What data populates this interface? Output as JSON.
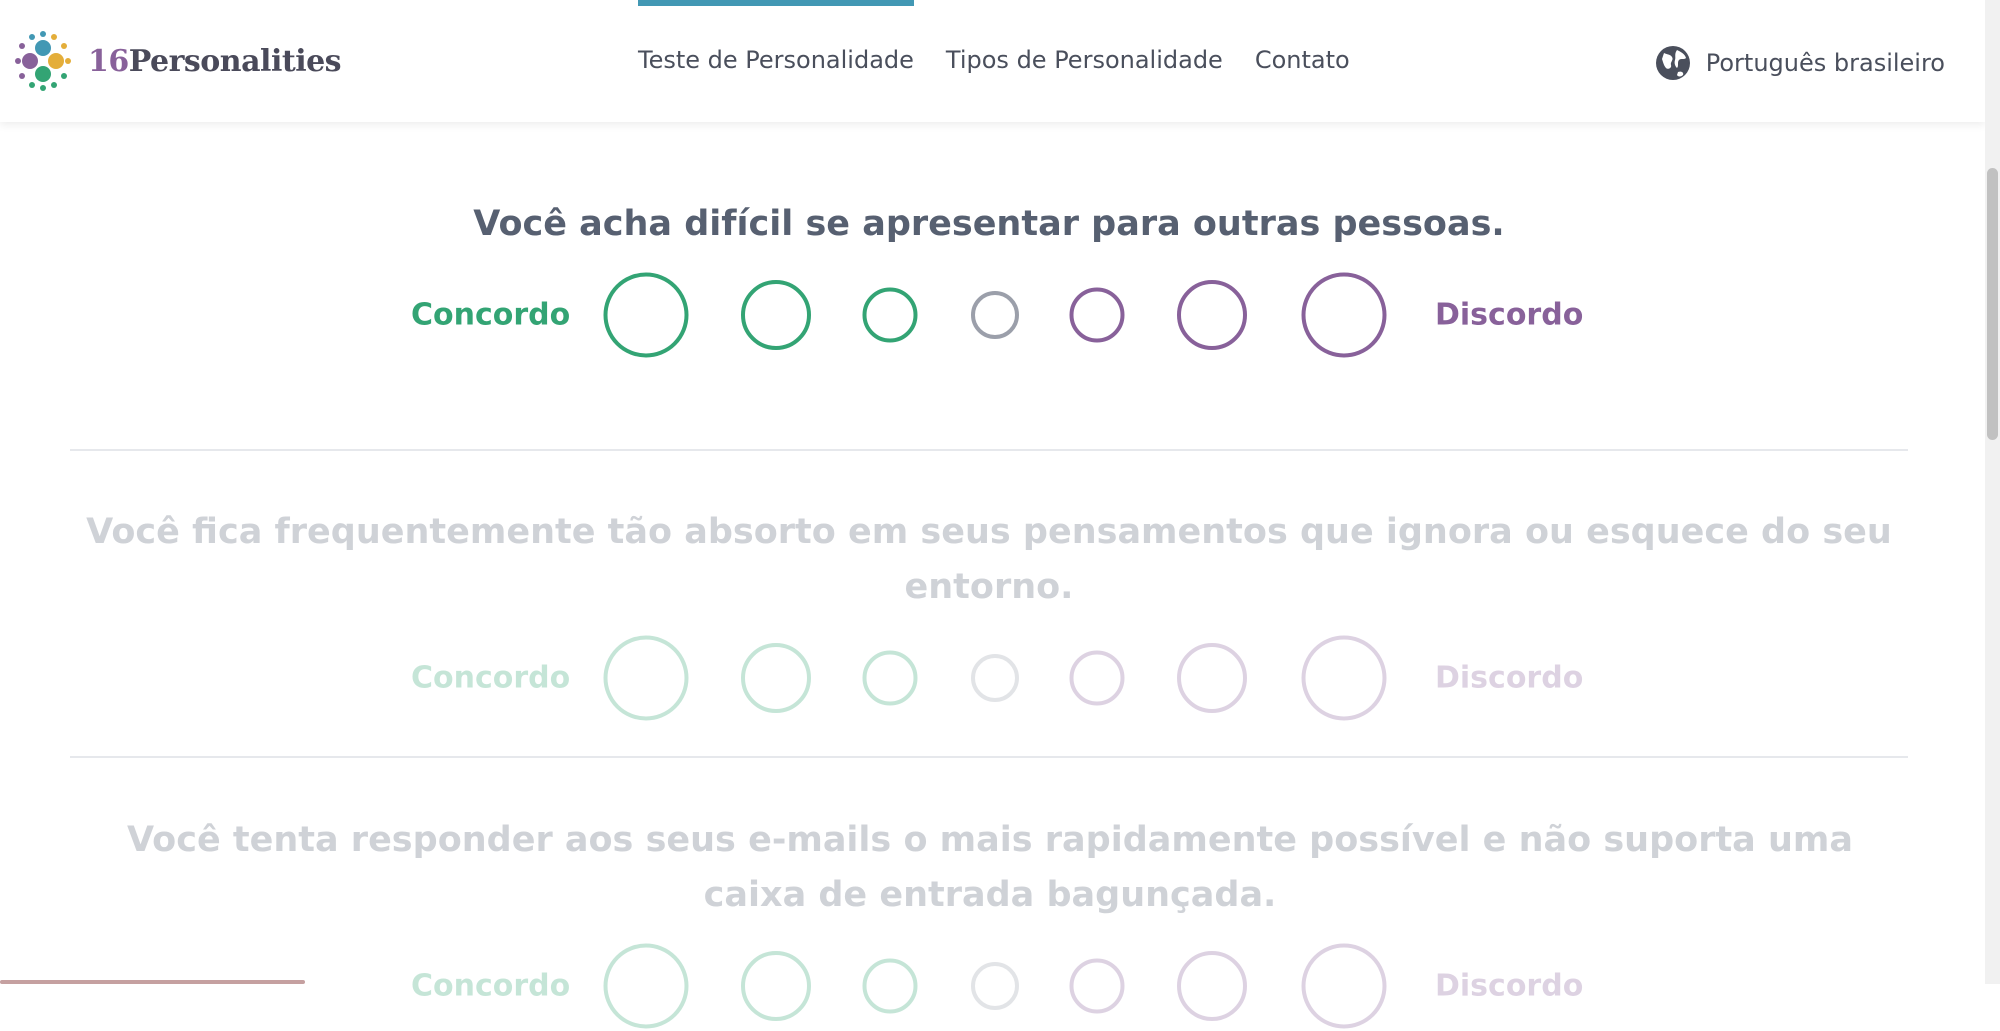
{
  "brand": {
    "num": "16",
    "name": "Personalities"
  },
  "nav": {
    "items": [
      {
        "label": "Teste de Personalidade",
        "active": true
      },
      {
        "label": "Tipos de Personalidade",
        "active": false
      },
      {
        "label": "Contato",
        "active": false
      }
    ]
  },
  "language": {
    "label": "Português brasileiro",
    "icon": "globe-icon"
  },
  "colors": {
    "agree": "#33a474",
    "disagree": "#88619a",
    "neutral": "#9b9faa",
    "accent": "#4298b4",
    "text": "#576071"
  },
  "questions": [
    {
      "text": "Você acha difícil se apresentar para outras pessoas.",
      "agree": "Concordo",
      "disagree": "Discordo"
    },
    {
      "text": "Você fica frequentemente tão absorto em seus pensamentos que ignora ou esquece do seu entorno.",
      "agree": "Concordo",
      "disagree": "Discordo"
    },
    {
      "text": "Você tenta responder aos seus e-mails o mais rapidamente possível e não suporta uma caixa de entrada bagunçada.",
      "agree": "Concordo",
      "disagree": "Discordo"
    }
  ]
}
